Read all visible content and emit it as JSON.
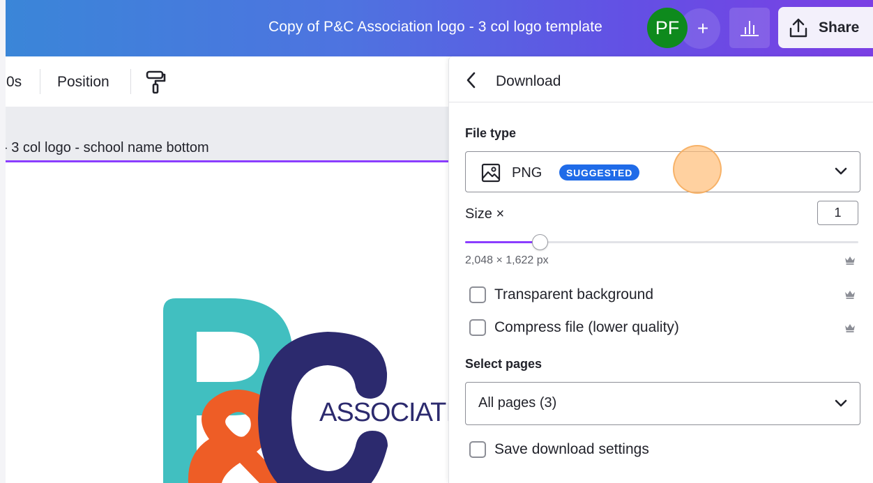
{
  "header": {
    "doc_title": "Copy of P&C Association logo - 3 col logo template",
    "avatar_initials": "PF",
    "add_symbol": "+",
    "share_label": "Share",
    "icons": {
      "add": "plus-icon",
      "stats": "bar-chart-icon",
      "share": "share-upload-icon"
    },
    "colors": {
      "gradient_start": "#3a86d8",
      "gradient_end": "#7b3fe4",
      "avatar": "#0e8a1d"
    }
  },
  "toolbar": {
    "items": [
      "0s",
      "Position"
    ],
    "icons": {
      "copy_style": "paint-roller-icon"
    }
  },
  "canvas": {
    "page_title": "- 3 col logo - school name bottom",
    "logo": {
      "letters": [
        "P",
        "&",
        "C"
      ],
      "association_text": "ASSOCIATIO",
      "colors": {
        "p": "#41bfc0",
        "ampersand": "#ee5d26",
        "c": "#2c2a6e",
        "text": "#2c2a6e"
      }
    },
    "colors": {
      "accent": "#8b3dff"
    }
  },
  "download_panel": {
    "title": "Download",
    "back_icon": "chevron-left-icon",
    "file_type": {
      "label": "File type",
      "value": "PNG",
      "badge": "SUGGESTED",
      "icon": "image-icon",
      "chevron": "chevron-down-icon"
    },
    "size": {
      "label": "Size ×",
      "value": "1",
      "slider_fraction": 0.19,
      "dimensions": "2,048 × 1,622 px"
    },
    "options": [
      {
        "label": "Transparent background",
        "checked": false,
        "premium": true
      },
      {
        "label": "Compress file (lower quality)",
        "checked": false,
        "premium": true
      }
    ],
    "select_pages": {
      "label": "Select pages",
      "value": "All pages (3)",
      "chevron": "chevron-down-icon"
    },
    "save_settings": {
      "label": "Save download settings",
      "checked": false
    },
    "premium_icon": "crown-icon",
    "colors": {
      "badge": "#1f6be8",
      "slider": "#8b3dff"
    }
  }
}
